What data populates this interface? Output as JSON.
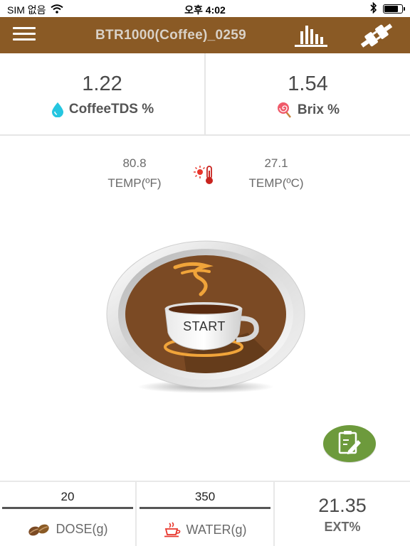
{
  "status_bar": {
    "carrier": "SIM 없음",
    "time": "오후 4:02",
    "battery_level": 0.85
  },
  "header": {
    "title": "BTR1000(Coffee)_0259",
    "icons": [
      "menu-icon",
      "bar-chart-icon",
      "plug-connect-icon"
    ],
    "color": "#8a5a25"
  },
  "readings": {
    "tds": {
      "value": "1.22",
      "label": "CoffeeTDS %",
      "icon": "water-drop-icon"
    },
    "brix": {
      "value": "1.54",
      "label": "Brix %",
      "icon": "lollipop-icon"
    }
  },
  "temperature": {
    "fahrenheit": {
      "value": "80.8",
      "label": "TEMP(ºF)"
    },
    "celsius": {
      "value": "27.1",
      "label": "TEMP(ºC)"
    },
    "icon": "thermometer-sun-icon"
  },
  "start_button": {
    "label": "START",
    "icon": "coffee-cup-icon"
  },
  "memo_button": {
    "icon": "clipboard-edit-icon",
    "color": "#6d9a3c"
  },
  "bottom": {
    "dose": {
      "value": "20",
      "label": "DOSE(g)",
      "icon": "coffee-beans-icon"
    },
    "water": {
      "value": "350",
      "label": "WATER(g)",
      "icon": "cup-icon"
    },
    "ext": {
      "value": "21.35",
      "label": "EXT%"
    }
  }
}
